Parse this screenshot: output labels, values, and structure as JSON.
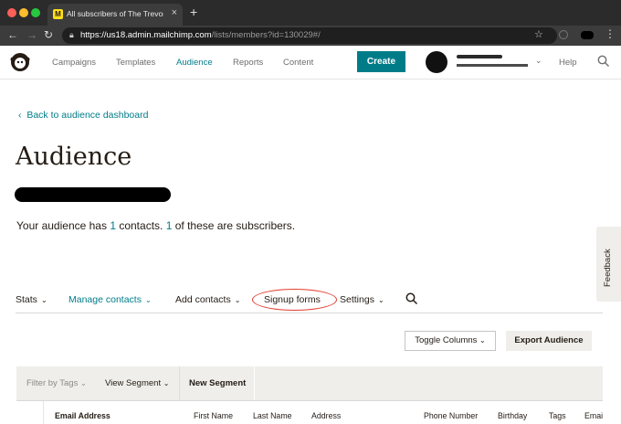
{
  "browser": {
    "tab_title": "All subscribers of The Trevor H",
    "url_main": "https://us18.admin.mailchimp.com",
    "url_path": "/lists/members?id=130029#/"
  },
  "header": {
    "nav": [
      "Campaigns",
      "Templates",
      "Audience",
      "Reports",
      "Content"
    ],
    "active_nav": "Audience",
    "create_label": "Create",
    "help_label": "Help"
  },
  "page": {
    "back_link": "Back to audience dashboard",
    "title": "Audience",
    "summary_prefix": "Your audience has ",
    "contacts_count": "1",
    "summary_middle": " contacts. ",
    "subscribers_count": "1",
    "summary_suffix": " of these are subscribers."
  },
  "feedback_label": "Feedback",
  "subnav": {
    "stats": "Stats",
    "manage_contacts": "Manage contacts",
    "add_contacts": "Add contacts",
    "signup_forms": "Signup forms",
    "settings": "Settings"
  },
  "actions": {
    "toggle_columns": "Toggle Columns",
    "export_audience": "Export Audience"
  },
  "filterbar": {
    "filter_by_tags": "Filter by Tags",
    "view_segment": "View Segment",
    "new_segment": "New Segment"
  },
  "table": {
    "columns": [
      "Email Address",
      "First Name",
      "Last Name",
      "Address",
      "Phone Number",
      "Birthday",
      "Tags",
      "Emai"
    ]
  },
  "colors": {
    "accent": "#007c89",
    "annotation_circle": "#e23b2e"
  }
}
